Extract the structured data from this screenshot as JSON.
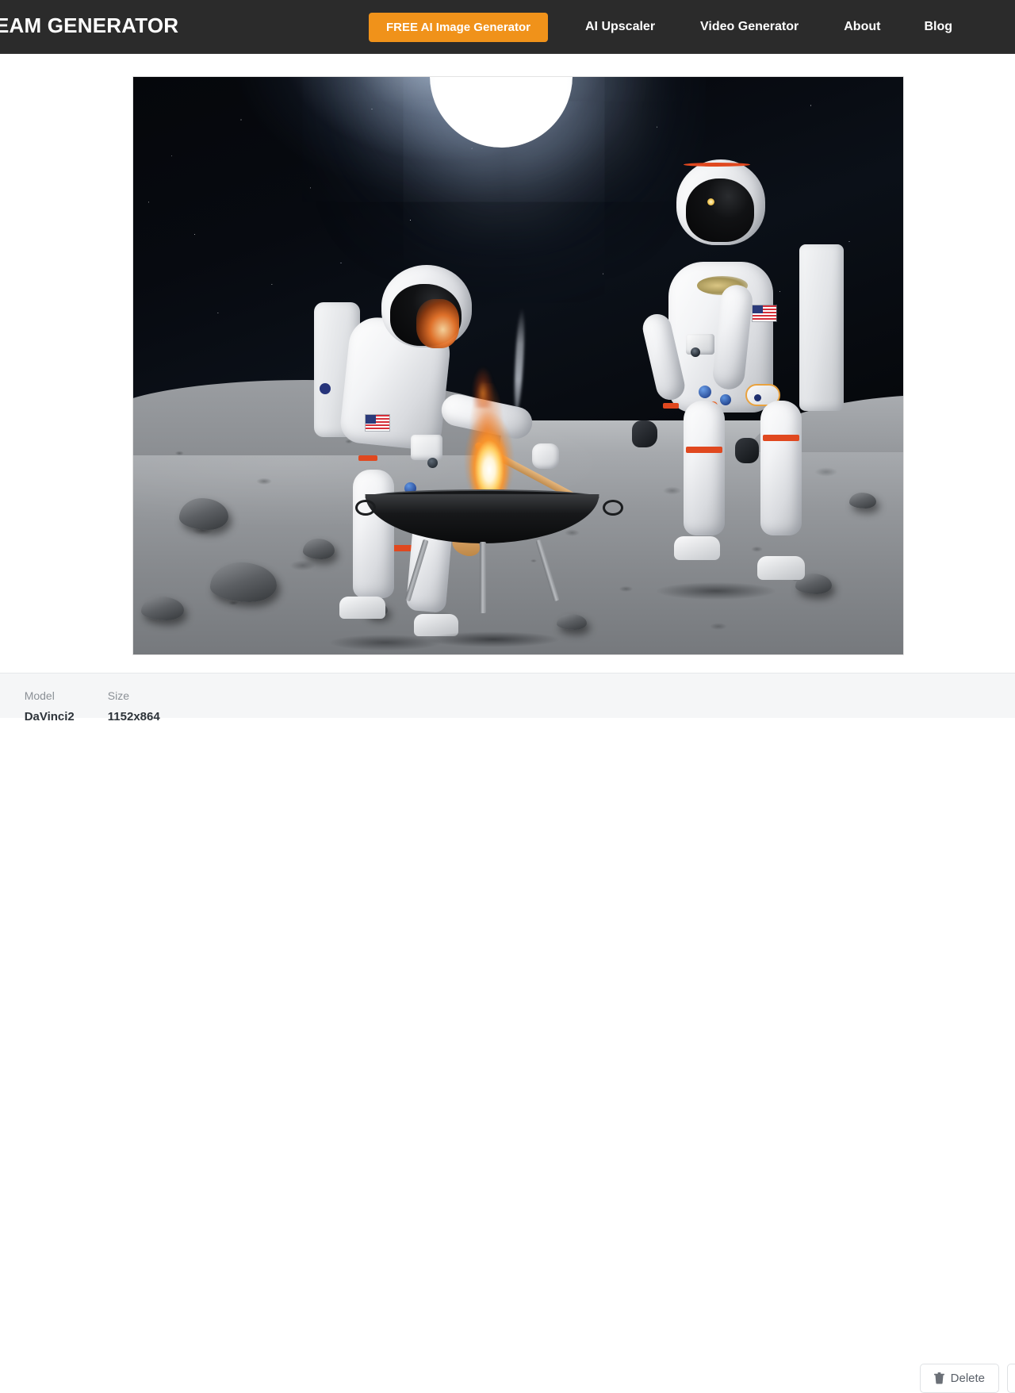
{
  "header": {
    "brand": "DREAM GENERATOR",
    "cta": {
      "label": "FREE AI Image Generator",
      "color": "#f0921a"
    },
    "links": [
      {
        "name": "ai-upscaler",
        "label": "AI Upscaler"
      },
      {
        "name": "video-generator",
        "label": "Video Generator"
      },
      {
        "name": "about",
        "label": "About"
      },
      {
        "name": "blog",
        "label": "Blog"
      }
    ]
  },
  "image": {
    "alt": "Two astronauts in white spacesuits cooking over a flaming fire pit on the grey lunar surface under a black starry sky with a bright sun",
    "subjects": [
      "astronaut-left-stirring-with-wooden-spoon",
      "astronaut-right-standing",
      "fire-pit-bowl-with-flames",
      "lunar-surface",
      "sun",
      "starfield"
    ]
  },
  "meta": {
    "columns": [
      "Model",
      "Size"
    ],
    "row": {
      "id": "25",
      "model": "DaVinci2",
      "size": "1152x864"
    }
  },
  "actions": [
    {
      "name": "delete",
      "label": "Delete",
      "icon": "trash-icon"
    },
    {
      "name": "secondary",
      "label": "",
      "icon": ""
    }
  ]
}
